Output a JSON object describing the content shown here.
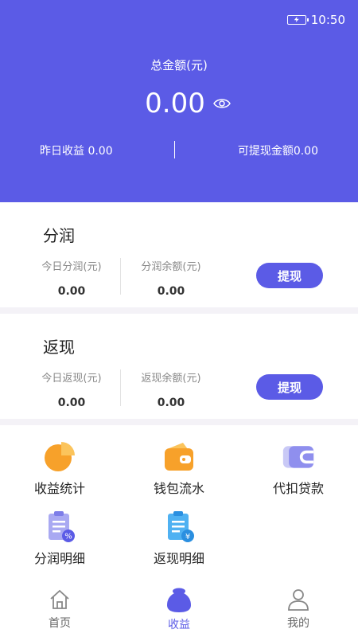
{
  "status_bar": {
    "time": "10:50"
  },
  "header": {
    "total_label": "总金额(元)",
    "total_value": "0.00",
    "yesterday": "昨日收益 0.00",
    "withdrawable": "可提现金额0.00"
  },
  "fenrun": {
    "title": "分润",
    "today_label": "今日分润(元)",
    "today_value": "0.00",
    "balance_label": "分润余额(元)",
    "balance_value": "0.00",
    "button": "提现"
  },
  "fanxian": {
    "title": "返现",
    "today_label": "今日返现(元)",
    "today_value": "0.00",
    "balance_label": "返现余额(元)",
    "balance_value": "0.00",
    "button": "提现"
  },
  "grid": {
    "items": [
      {
        "label": "收益统计",
        "icon": "pie-chart-icon"
      },
      {
        "label": "钱包流水",
        "icon": "wallet-icon"
      },
      {
        "label": "代扣贷款",
        "icon": "card-wallet-icon"
      },
      {
        "label": "分润明细",
        "icon": "percent-clipboard-icon"
      },
      {
        "label": "返现明细",
        "icon": "yuan-clipboard-icon"
      }
    ]
  },
  "nav": {
    "items": [
      {
        "label": "首页",
        "icon": "home-icon"
      },
      {
        "label": "收益",
        "icon": "money-bag-icon"
      },
      {
        "label": "我的",
        "icon": "user-icon"
      }
    ],
    "active_index": 1
  },
  "colors": {
    "brand": "#5b5be6",
    "orange": "#f7a12a",
    "lavender": "#a9a9f2"
  }
}
